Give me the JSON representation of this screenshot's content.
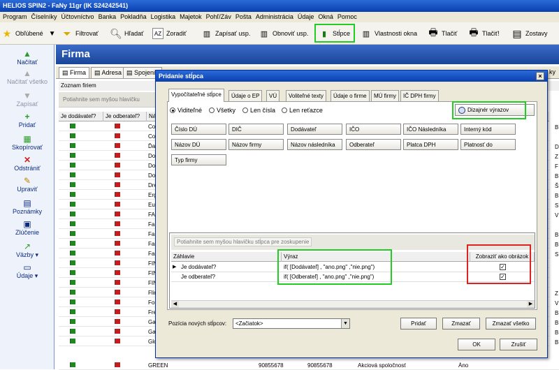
{
  "window": {
    "title": "HELIOS SPIN2 - FaNy 11gr (IK S24242541)"
  },
  "menu": [
    "Program",
    "Číselníky",
    "Účtovníctvo",
    "Banka",
    "Pokladňa",
    "Logistika",
    "Majetok",
    "Pohľ/Záv",
    "Pošta",
    "Administrácia",
    "Údaje",
    "Okná",
    "Pomoc"
  ],
  "toolbar": {
    "favorites": "Obľúbené",
    "filter": "Filtrovať",
    "search": "Hľadať",
    "sort": "Zoradiť",
    "write": "Zapísať usp.",
    "refresh": "Obnoviť usp.",
    "columns": "Stĺpce",
    "window_props": "Vlastnosti okna",
    "print": "Tlačiť",
    "print2": "Tlačiť!",
    "reports": "Zostavy"
  },
  "sidebar": [
    "Načítať",
    "Načítať všetko",
    "Zapísať",
    "Pridať",
    "Skopírovať",
    "Odstrániť",
    "Upraviť",
    "Poznámky",
    "Zlúčenie",
    "Väzby",
    "Údaje"
  ],
  "main": {
    "title": "Firma",
    "tabs": [
      "Firma",
      "Adresa",
      "Spojenie"
    ],
    "list_title": "Zoznam firiem",
    "group_hint": "Potiahnite sem myšou hlavičku",
    "columns": [
      "Je dodávateľ?",
      "Je odberateľ?",
      "Ná"
    ],
    "rows": [
      {
        "d": "g",
        "o": "r",
        "n": "Col"
      },
      {
        "d": "g",
        "o": "r",
        "n": "Cor"
      },
      {
        "d": "g",
        "o": "r",
        "n": "Ďal"
      },
      {
        "d": "g",
        "o": "r",
        "n": "Dol"
      },
      {
        "d": "g",
        "o": "r",
        "n": "Doo"
      },
      {
        "d": "g",
        "o": "r",
        "n": "Doo"
      },
      {
        "d": "g",
        "o": "r",
        "n": "Dre"
      },
      {
        "d": "g",
        "o": "r",
        "n": "Erg"
      },
      {
        "d": "g",
        "o": "r",
        "n": "Eur"
      },
      {
        "d": "g",
        "o": "r",
        "n": "FAN"
      },
      {
        "d": "g",
        "o": "r",
        "n": "FaN"
      },
      {
        "d": "g",
        "o": "r",
        "n": "FaN"
      },
      {
        "d": "g",
        "o": "r",
        "n": "Far"
      },
      {
        "d": "g",
        "o": "r",
        "n": "Fas"
      },
      {
        "d": "g",
        "o": "r",
        "n": "FIN"
      },
      {
        "d": "g",
        "o": "r",
        "n": "FIN"
      },
      {
        "d": "g",
        "o": "r",
        "n": "FIN"
      },
      {
        "d": "g",
        "o": "r",
        "n": "Flin"
      },
      {
        "d": "g",
        "o": "r",
        "n": "For"
      },
      {
        "d": "g",
        "o": "r",
        "n": "Fre"
      },
      {
        "d": "g",
        "o": "r",
        "n": "Gal"
      },
      {
        "d": "g",
        "o": "r",
        "n": "Gal"
      },
      {
        "d": "g",
        "o": "r",
        "n": "Glo"
      }
    ],
    "last_row": {
      "name": "GREEN",
      "ico": "90855678",
      "dic": "90855678",
      "form": "Akciová spoločnosť",
      "val": "Áno"
    },
    "right_peek": [
      "B",
      "",
      "D",
      "Z",
      "F",
      "B",
      "Š",
      "B",
      "S",
      "V",
      "",
      "B",
      "B",
      "S",
      "",
      "",
      "",
      "Z",
      "V",
      "B",
      "B",
      "B",
      "B"
    ],
    "partial_tab": "ky"
  },
  "dialog": {
    "title": "Pridanie stĺpca",
    "close": "×",
    "tabs": [
      "Vypočítateľné stĺpce",
      "Údaje o EP",
      "VÚ",
      "Voliteľné texty",
      "Údaje o firme",
      "MÚ firmy",
      "IČ DPH firmy"
    ],
    "radios": [
      {
        "label": "Viditeľné",
        "on": true
      },
      {
        "label": "Všetky",
        "on": false
      },
      {
        "label": "Len čísla",
        "on": false
      },
      {
        "label": "Len reťazce",
        "on": false
      }
    ],
    "design_button": "Dizajnér výrazov",
    "fields": [
      [
        "Číslo DÚ",
        "DIČ",
        "Dodávateľ",
        "IČO",
        "IČO Následníka",
        "Interný kód"
      ],
      [
        "Názov DÚ",
        "Názov firmy",
        "Názov následníka",
        "Odberateľ",
        "Platca DPH",
        "Platnosť do"
      ],
      [
        "Typ firmy"
      ]
    ],
    "grid": {
      "group_hint": "Potiahnite sem myšou hlavičku stĺpca pre zoskupenie",
      "headers": [
        "Záhlavie",
        "Výraz",
        "Zobraziť ako obrázok"
      ],
      "rows": [
        {
          "header": "Je dodávateľ?",
          "expr": "if( [Dodávateľ] , \"ano.png\" ,\"nie.png\")",
          "img": "✓"
        },
        {
          "header": "Je odberateľ?",
          "expr": "if( [Odberateľ] , \"ano.png\" ,\"nie.png\")",
          "img": "✓"
        }
      ]
    },
    "position_label": "Pozícia nových stĺpcov:",
    "position_value": "<Začiatok>",
    "add": "Pridať",
    "remove": "Zmazať",
    "remove_all": "Zmazať všetko",
    "ok": "OK",
    "cancel": "Zrušiť"
  },
  "colors": {
    "highlight_green": "#22cc22",
    "highlight_red": "#dd2222",
    "title_blue": "#0a3fae"
  }
}
